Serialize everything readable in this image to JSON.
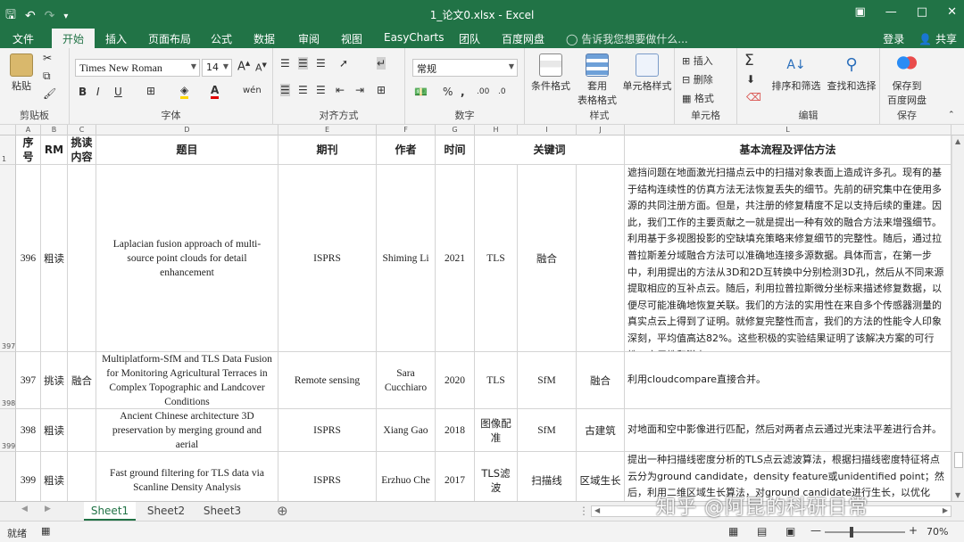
{
  "window": {
    "title": "1_论文0.xlsx - Excel",
    "save_icon": "save-icon",
    "undo_icon": "undo-icon",
    "redo_icon": "redo-icon"
  },
  "tabs": [
    "文件",
    "开始",
    "插入",
    "页面布局",
    "公式",
    "数据",
    "审阅",
    "视图",
    "EasyCharts",
    "团队",
    "百度网盘"
  ],
  "active_tab": "开始",
  "tell_me": "告诉我您想要做什么...",
  "account": {
    "login": "登录",
    "share": "共享"
  },
  "ribbon": {
    "clipboard": {
      "paste": "粘贴",
      "label": "剪贴板"
    },
    "font": {
      "name": "Times New Roman",
      "size": "14",
      "label": "字体",
      "bold": "B",
      "italic": "I",
      "underline": "U",
      "wen": "wén"
    },
    "alignment": {
      "label": "对齐方式"
    },
    "number": {
      "format": "常规",
      "label": "数字",
      "percent": "%",
      "comma": ","
    },
    "styles": {
      "conditional": "条件格式",
      "table": "套用",
      "table2": "表格格式",
      "cell": "单元格样式",
      "label": "样式"
    },
    "cells": {
      "insert": "插入",
      "delete": "删除",
      "format": "格式",
      "label": "单元格"
    },
    "editing": {
      "sum": "Σ",
      "sort": "排序和筛选",
      "find": "查找和选择",
      "label": "编辑"
    },
    "save": {
      "line1": "保存到",
      "line2": "百度网盘",
      "label": "保存"
    }
  },
  "columns": [
    "A",
    "B",
    "C",
    "D",
    "E",
    "F",
    "G",
    "H",
    "I",
    "J",
    "L"
  ],
  "header": {
    "row_num": "1",
    "no": "序号",
    "rm": "RM",
    "pick": "挑读内容",
    "title": "题目",
    "journal": "期刊",
    "author": "作者",
    "year": "时间",
    "keywords": "关键词",
    "method": "基本流程及评估方法"
  },
  "rows": [
    {
      "row_num": "397",
      "no": "396",
      "rm": "粗读",
      "pick": "",
      "title": "Laplacian fusion approach of multi-source point clouds for detail enhancement",
      "journal": "ISPRS",
      "author": "Shiming Li",
      "year": "2021",
      "kw1": "TLS",
      "kw2": "融合",
      "kw3": "",
      "method": "遮挡问题在地面激光扫描点云中的扫描对象表面上造成许多孔。现有的基于结构连续性的仿真方法无法恢复丢失的细节。先前的研究集中在使用多源的共同注册方面。但是，共注册的修复精度不足以支持后续的重建。因此，我们工作的主要贡献之一就是提出一种有效的融合方法来增强细节。利用基于多视图投影的空缺填充策略来修复细节的完整性。随后，通过拉普拉斯差分域融合方法可以准确地连接多源数据。具体而言，在第一步中，利用提出的方法从3D和2D互转换中分别检测3D孔，然后从不同来源提取相应的互补点云。随后，利用拉普拉斯微分坐标来描述修复数据，以便尽可能准确地恢复关联。我们的方法的实用性在来自多个传感器测量的真实点云上得到了证明。就修复完整性而言，我们的方法的性能令人印象深刻，平均值高达82%。这些积极的实验结果证明了该解决方案的可行性，实用性和潜力。"
    },
    {
      "row_num": "398",
      "no": "397",
      "rm": "挑读",
      "pick": "融合",
      "title": "Multiplatform-SfM and TLS Data Fusion for Monitoring Agricultural Terraces in Complex Topographic and Landcover Conditions",
      "journal": "Remote sensing",
      "author": "Sara Cucchiaro",
      "year": "2020",
      "kw1": "TLS",
      "kw2": "SfM",
      "kw3": "融合",
      "method": "利用cloudcompare直接合并。"
    },
    {
      "row_num": "399",
      "no": "398",
      "rm": "粗读",
      "pick": "",
      "title": "Ancient Chinese architecture 3D preservation by merging ground and aerial",
      "journal": "ISPRS",
      "author": "Xiang Gao",
      "year": "2018",
      "kw1": "图像配准",
      "kw2": "SfM",
      "kw3": "古建筑",
      "method": "对地面和空中影像进行匹配，然后对两者点云通过光束法平差进行合并。"
    },
    {
      "row_num": "",
      "no": "399",
      "rm": "粗读",
      "pick": "",
      "title": "Fast ground filtering for TLS data via Scanline Density Analysis",
      "journal": "ISPRS",
      "author": "Erzhuo Che",
      "year": "2017",
      "kw1": "TLS滤波",
      "kw2": "扫描线",
      "kw3": "区域生长",
      "method": "提出一种扫描线密度分析的TLS点云滤波算法，根据扫描线密度特征将点云分为ground candidate，density feature或unidentified point；然后，利用二维区域生长算法，对ground candidate进行生长，以优化"
    }
  ],
  "sheets": [
    "Sheet1",
    "Sheet2",
    "Sheet3"
  ],
  "active_sheet": "Sheet1",
  "status": {
    "ready": "就绪",
    "zoom": "70%"
  },
  "watermark": "知乎 @阿昆的科研日常"
}
